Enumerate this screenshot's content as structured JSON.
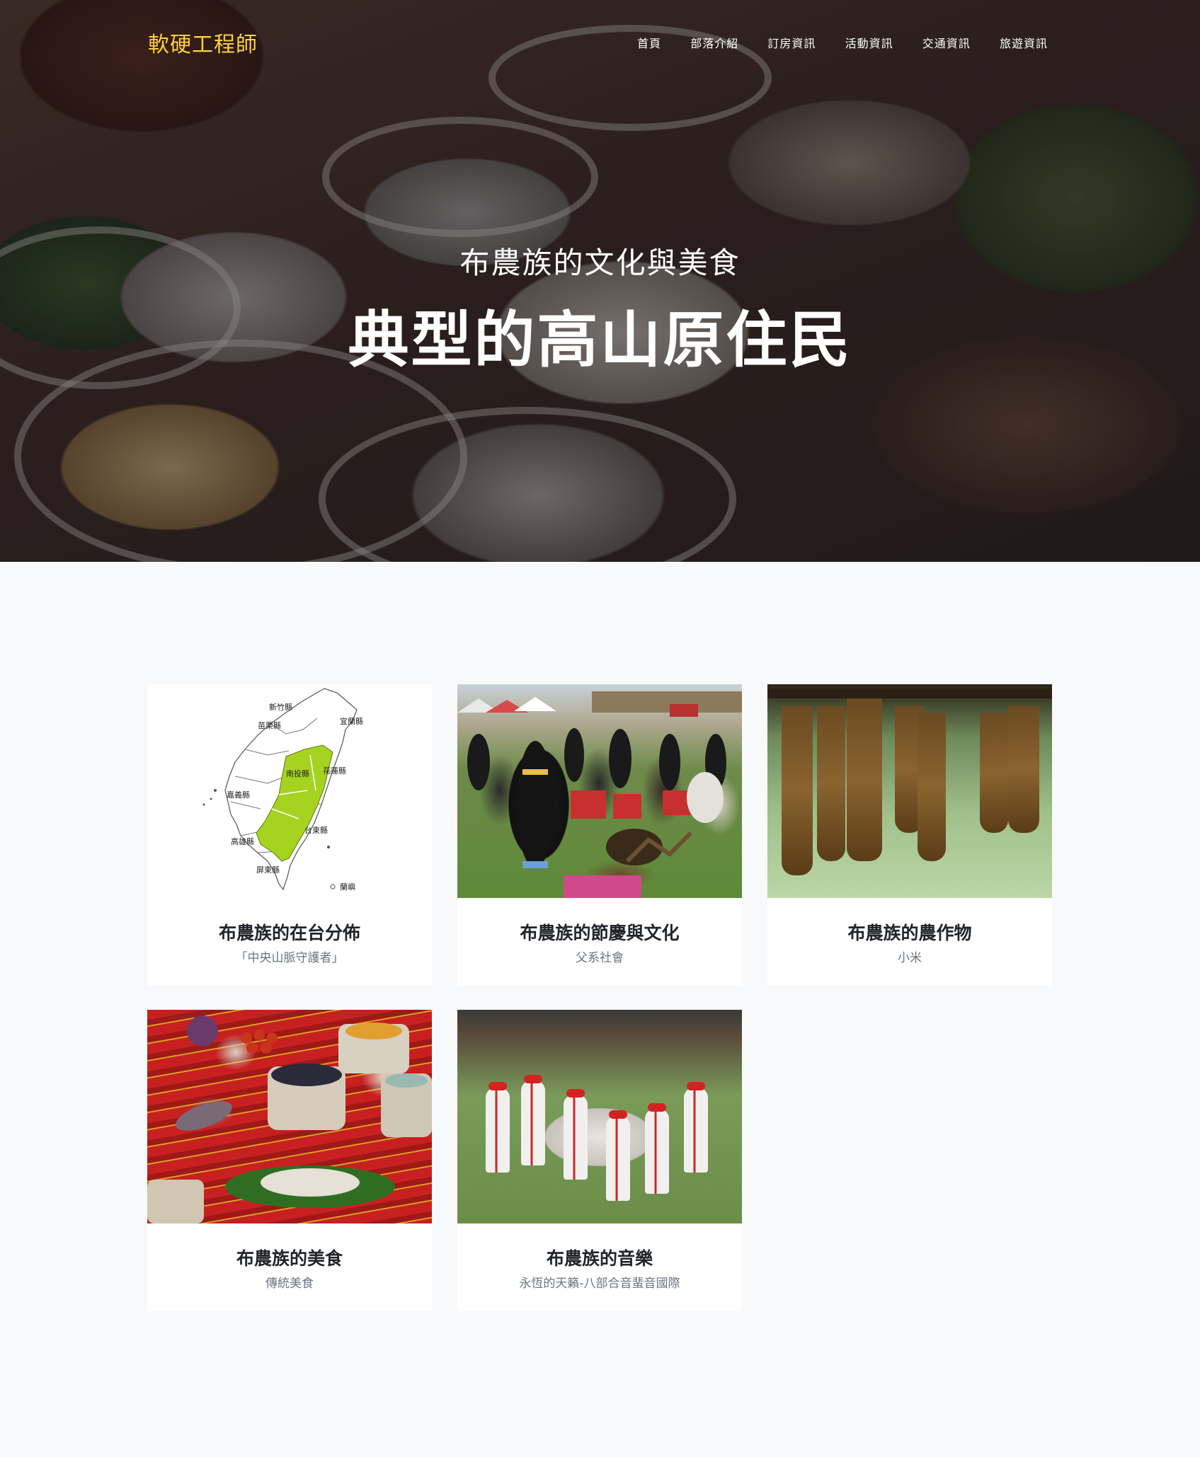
{
  "brand": {
    "name": "軟硬工程師",
    "color": "#fed136"
  },
  "nav": [
    {
      "label": "首頁"
    },
    {
      "label": "部落介紹"
    },
    {
      "label": "訂房資訊"
    },
    {
      "label": "活動資訊"
    },
    {
      "label": "交通資訊"
    },
    {
      "label": "旅遊資訊"
    }
  ],
  "hero": {
    "subtitle": "布農族的文化與美食",
    "title": "典型的高山原住民",
    "image": "food-table-photo"
  },
  "cards": [
    {
      "title": "布農族的在台分佈",
      "subtitle": "「中央山脈守護者」",
      "image": "taiwan-map-image"
    },
    {
      "title": "布農族的節慶與文化",
      "subtitle": "父系社會",
      "image": "festival-photo"
    },
    {
      "title": "布農族的農作物",
      "subtitle": "小米",
      "image": "millet-photo"
    },
    {
      "title": "布農族的美食",
      "subtitle": "傳統美食",
      "image": "traditional-food-photo"
    },
    {
      "title": "布農族的音樂",
      "subtitle": "永恆的天籟-八部合音蜚音國際",
      "image": "music-circle-photo"
    }
  ],
  "map": {
    "labels": [
      "新竹縣",
      "苗栗縣",
      "宜蘭縣",
      "南投縣",
      "花蓮縣",
      "嘉義縣",
      "台東縣",
      "高雄縣",
      "屏東縣",
      "蘭嶼"
    ],
    "highlight_color": "#a6d320"
  },
  "colors": {
    "page_bg": "#f8f9fa",
    "card_bg": "#ffffff",
    "title": "#212529",
    "subtitle": "#6c757d"
  }
}
